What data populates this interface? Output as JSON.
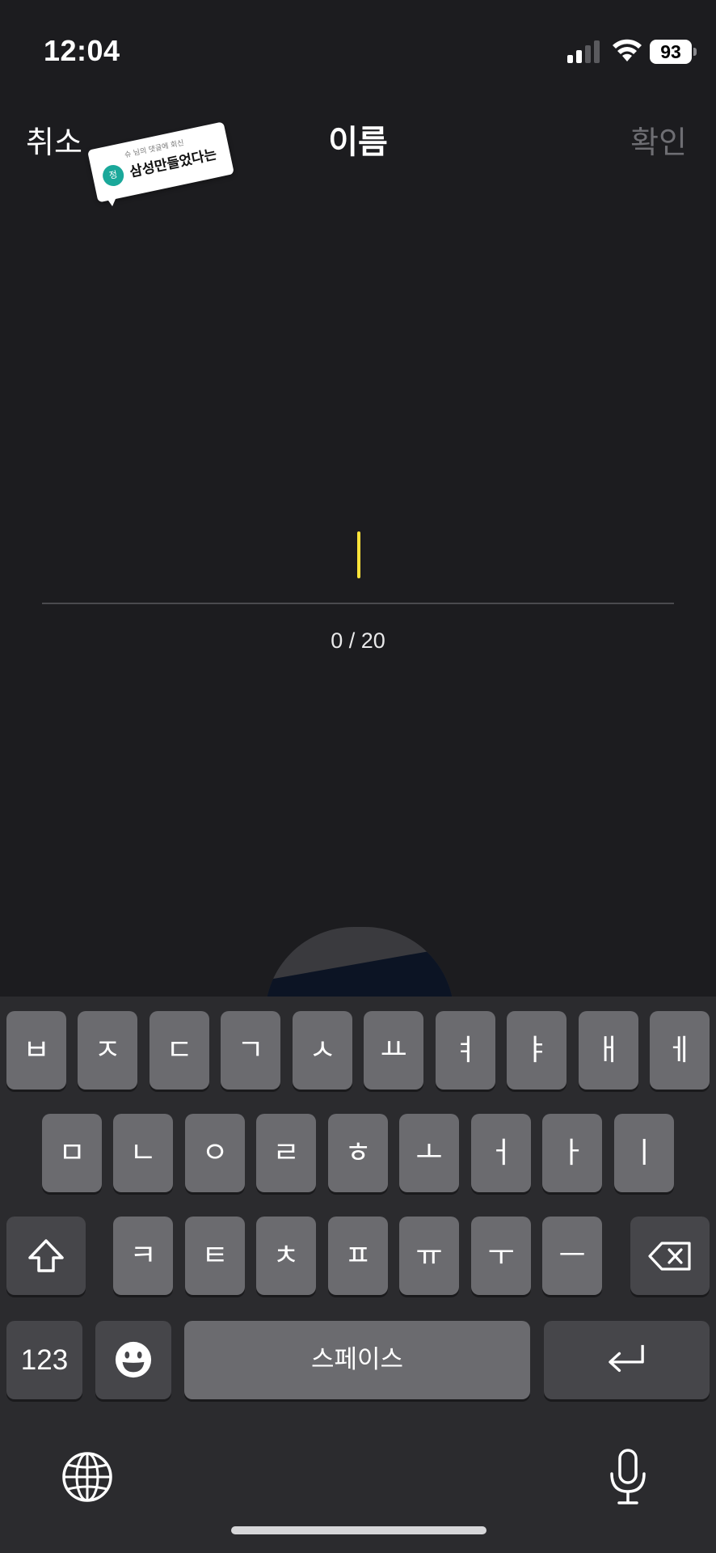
{
  "status_bar": {
    "time": "12:04",
    "battery": "93",
    "icons": [
      "signal-icon",
      "wifi-icon",
      "battery-icon"
    ]
  },
  "nav": {
    "cancel": "취소",
    "title": "이름",
    "confirm": "확인"
  },
  "sticker": {
    "caption": "슈 님의 댓글에 회신",
    "avatar": "정",
    "text": "삼성만들었다는"
  },
  "input": {
    "value": "",
    "char_count": "0 / 20"
  },
  "keyboard": {
    "row1": [
      "ㅂ",
      "ㅈ",
      "ㄷ",
      "ㄱ",
      "ㅅ",
      "ㅛ",
      "ㅕ",
      "ㅑ",
      "ㅐ",
      "ㅔ"
    ],
    "row2": [
      "ㅁ",
      "ㄴ",
      "ㅇ",
      "ㄹ",
      "ㅎ",
      "ㅗ",
      "ㅓ",
      "ㅏ",
      "ㅣ"
    ],
    "row3": [
      "ㅋ",
      "ㅌ",
      "ㅊ",
      "ㅍ",
      "ㅠ",
      "ㅜ",
      "ㅡ"
    ],
    "numbers_label": "123",
    "space_label": "스페이스",
    "icons": [
      "shift-icon",
      "backspace-icon",
      "emoji-icon",
      "return-icon",
      "globe-icon",
      "microphone-icon"
    ]
  },
  "colors": {
    "background": "#1c1c1f",
    "cursor": "#ffe33a",
    "keyboard_bg": "#2b2b2e",
    "key": "#6b6b6f",
    "key_dark": "#46464a",
    "confirm_disabled": "#6e6e73"
  }
}
